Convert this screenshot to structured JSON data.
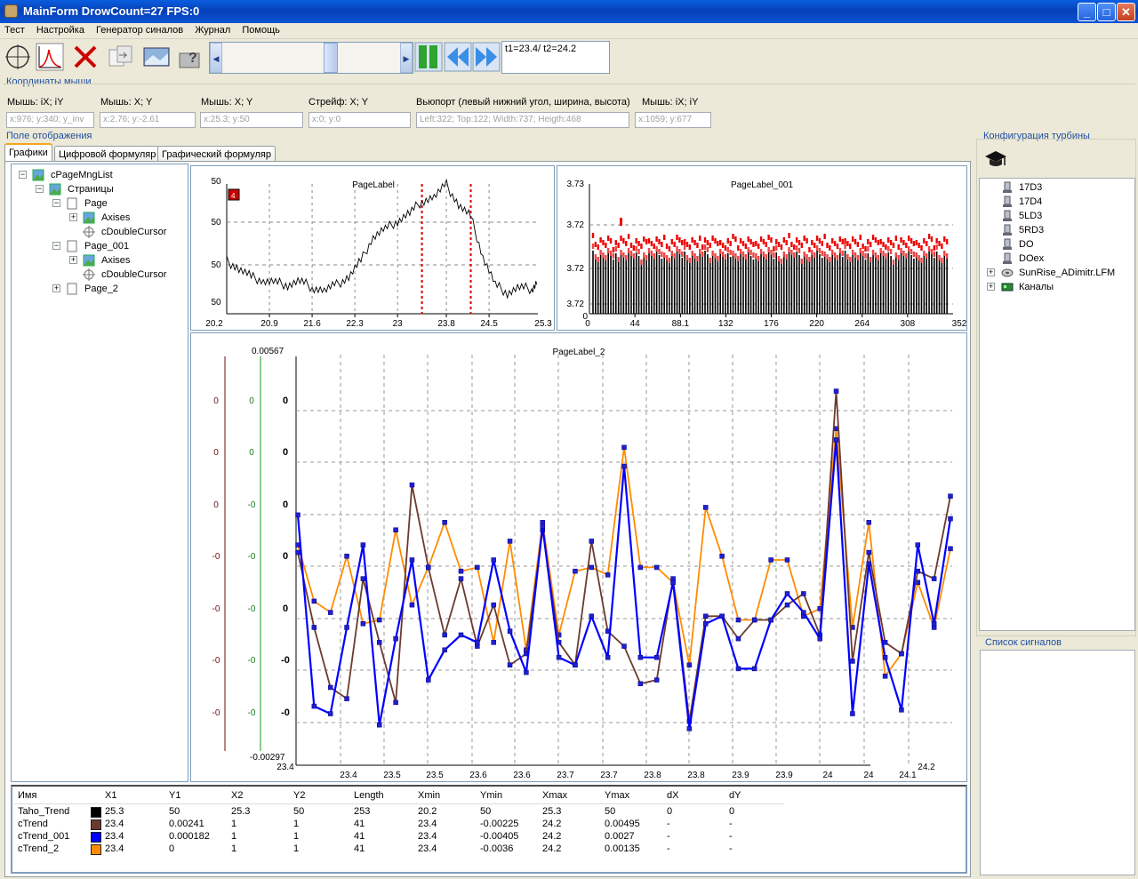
{
  "window": {
    "title": "MainForm DrowCount=27 FPS:0",
    "min": "_",
    "max": "□",
    "close": "✕"
  },
  "menu": [
    "Тест",
    "Настройка",
    "Генератор синалов",
    "Журнал",
    "Помощь"
  ],
  "toolbar": {
    "t1t2": "t1=23.4/ t2=24.2"
  },
  "mouse_coords": {
    "group": "Координаты мыши",
    "fields": [
      {
        "label": "Мышь: iX; iY",
        "value": "x:976; y:340; y_inv"
      },
      {
        "label": "Мышь: X; Y",
        "value": "x:2.76; y:-2.61"
      },
      {
        "label": "Мышь: X; Y",
        "value": "x:25.3; y:50"
      },
      {
        "label": "Стрейф: X; Y",
        "value": "x:0; y:0"
      },
      {
        "label": "Вьюпорт (левый нижний угол, ширина, высота)",
        "value": "Left:322; Top:122; Width:737; Heigth:468"
      },
      {
        "label": "Мышь: iX; iY",
        "value": "x:1059; y:677"
      }
    ]
  },
  "display": {
    "group": "Поле отображения",
    "tabs": [
      "Графики",
      "Цифровой формуляр",
      "Графический формуляр"
    ]
  },
  "tree": [
    {
      "label": "cPageMngList",
      "level": 0,
      "exp": "−",
      "icon": "page-manager"
    },
    {
      "label": "Страницы",
      "level": 1,
      "exp": "−",
      "icon": "pages"
    },
    {
      "label": "Page",
      "level": 2,
      "exp": "−",
      "icon": "page"
    },
    {
      "label": "Axises",
      "level": 3,
      "exp": "+",
      "icon": "axes"
    },
    {
      "label": "cDoubleCursor",
      "level": 3,
      "exp": "",
      "icon": "cursor"
    },
    {
      "label": "Page_001",
      "level": 2,
      "exp": "−",
      "icon": "page"
    },
    {
      "label": "Axises",
      "level": 3,
      "exp": "+",
      "icon": "axes"
    },
    {
      "label": "cDoubleCursor",
      "level": 3,
      "exp": "",
      "icon": "cursor"
    },
    {
      "label": "Page_2",
      "level": 2,
      "exp": "+",
      "icon": "page"
    }
  ],
  "turbine": {
    "group": "Конфигурация турбины",
    "items": [
      {
        "label": "17D3",
        "icon": "sensor",
        "exp": ""
      },
      {
        "label": "17D4",
        "icon": "sensor",
        "exp": ""
      },
      {
        "label": "5LD3",
        "icon": "sensor",
        "exp": ""
      },
      {
        "label": "5RD3",
        "icon": "sensor",
        "exp": ""
      },
      {
        "label": "DO",
        "icon": "sensor",
        "exp": ""
      },
      {
        "label": "DOex",
        "icon": "sensor",
        "exp": ""
      },
      {
        "label": "SunRise_ADimitr.LFM",
        "icon": "disk",
        "exp": "+"
      },
      {
        "label": "Каналы",
        "icon": "channels",
        "exp": "+"
      }
    ]
  },
  "signals": {
    "group": "Список сигналов"
  },
  "legend": {
    "headers": [
      "Имя",
      "X1",
      "Y1",
      "X2",
      "Y2",
      "Length",
      "Xmin",
      "Ymin",
      "Xmax",
      "Ymax",
      "dX",
      "dY"
    ],
    "rows": [
      {
        "name": "Taho_Trend",
        "color": "#000000",
        "cells": [
          "25.3",
          "50",
          "25.3",
          "50",
          "253",
          "20.2",
          "50",
          "25.3",
          "50",
          "0",
          "0"
        ]
      },
      {
        "name": "cTrend",
        "color": "#6b3a2e",
        "cells": [
          "23.4",
          "0.00241",
          "1",
          "1",
          "41",
          "23.4",
          "-0.00225",
          "24.2",
          "0.00495",
          "-",
          "-"
        ]
      },
      {
        "name": "cTrend_001",
        "color": "#0000ff",
        "cells": [
          "23.4",
          "0.000182",
          "1",
          "1",
          "41",
          "23.4",
          "-0.00405",
          "24.2",
          "0.0027",
          "-",
          "-"
        ]
      },
      {
        "name": "cTrend_2",
        "color": "#ff8c00",
        "cells": [
          "23.4",
          "0",
          "1",
          "1",
          "41",
          "23.4",
          "-0.0036",
          "24.2",
          "0.00135",
          "-",
          "-"
        ]
      }
    ]
  },
  "chart_data": [
    {
      "type": "line",
      "title": "PageLabel",
      "ytick_labels": [
        "50",
        "50",
        "50",
        "50"
      ],
      "xtick_labels": [
        "20.2",
        "20.9",
        "21.6",
        "22.3",
        "23",
        "23.8",
        "24.5",
        "25.3"
      ],
      "xlim": [
        20.2,
        25.3
      ],
      "cursors": [
        23.4,
        24.2
      ],
      "badge": "4",
      "series": [
        {
          "color": "#000000",
          "x": [
            20.2,
            20.4,
            20.6,
            20.8,
            21.0,
            21.2,
            21.4,
            21.6,
            21.8,
            22.0,
            22.2,
            22.4,
            22.6,
            22.8,
            23.0,
            23.2,
            23.4,
            23.6,
            23.8,
            24.0,
            24.2,
            24.4,
            24.6,
            24.8,
            25.0,
            25.2,
            25.3
          ],
          "y": [
            0.55,
            0.45,
            0.35,
            0.3,
            0.28,
            0.25,
            0.3,
            0.22,
            0.18,
            0.25,
            0.35,
            0.55,
            0.85,
            0.95,
            1.05,
            1.15,
            1.3,
            1.35,
            1.5,
            1.25,
            1.1,
            0.6,
            0.25,
            0.15,
            0.22,
            0.2,
            0.3
          ]
        }
      ]
    },
    {
      "type": "bar",
      "title": "PageLabel_001",
      "ytick_labels": [
        "3.73",
        "3.72",
        "3.72",
        "3.72",
        "0"
      ],
      "xtick_labels": [
        "0",
        "44",
        "88.1",
        "132",
        "176",
        "220",
        "264",
        "308",
        "352"
      ],
      "xlim": [
        0,
        352
      ],
      "bars": 140
    },
    {
      "type": "line",
      "title": "PageLabel_2",
      "y_top": "0.00567",
      "y_bottom": "-0.00297",
      "left_axis_labels": [
        "0",
        "0",
        "0",
        "-0",
        "-0",
        "-0",
        "-0"
      ],
      "green_axis_labels": [
        "0",
        "0",
        "-0",
        "-0",
        "-0",
        "-0",
        "-0"
      ],
      "bold_axis_labels": [
        "0",
        "0",
        "0",
        "0",
        "0",
        "-0",
        "-0"
      ],
      "xtick_labels": [
        "23.4",
        "23.4",
        "23.5",
        "23.5",
        "23.6",
        "23.6",
        "23.7",
        "23.7",
        "23.8",
        "23.8",
        "23.9",
        "23.9",
        "24",
        "24",
        "24.1",
        "24.2"
      ],
      "x_start": "23.4",
      "series": [
        {
          "name": "cTrend",
          "color": "#6b3a2e",
          "y": [
            0.52,
            0.32,
            0.16,
            0.13,
            0.45,
            0.28,
            0.12,
            0.7,
            0.48,
            0.3,
            0.45,
            0.27,
            0.38,
            0.22,
            0.25,
            0.58,
            0.28,
            0.22,
            0.55,
            0.31,
            0.27,
            0.17,
            0.18,
            0.45,
            0.07,
            0.35,
            0.35,
            0.29,
            0.34,
            0.34,
            0.38,
            0.41,
            0.3,
            0.95,
            0.23,
            0.52,
            0.28,
            0.25,
            0.47,
            0.45,
            0.67
          ]
        },
        {
          "name": "cTrend_001",
          "color": "#0000ff",
          "y": [
            0.62,
            0.11,
            0.09,
            0.32,
            0.54,
            0.06,
            0.29,
            0.5,
            0.18,
            0.26,
            0.3,
            0.28,
            0.5,
            0.31,
            0.2,
            0.59,
            0.24,
            0.22,
            0.35,
            0.24,
            0.75,
            0.24,
            0.24,
            0.44,
            0.05,
            0.33,
            0.35,
            0.21,
            0.21,
            0.34,
            0.41,
            0.36,
            0.29,
            0.82,
            0.09,
            0.49,
            0.24,
            0.1,
            0.54,
            0.33,
            0.61
          ]
        },
        {
          "name": "cTrend_2",
          "color": "#ff8c00",
          "y": [
            0.54,
            0.39,
            0.36,
            0.51,
            0.33,
            0.34,
            0.58,
            0.38,
            0.48,
            0.6,
            0.47,
            0.48,
            0.28,
            0.55,
            0.26,
            0.6,
            0.3,
            0.47,
            0.48,
            0.46,
            0.8,
            0.48,
            0.48,
            0.44,
            0.22,
            0.64,
            0.51,
            0.34,
            0.34,
            0.5,
            0.5,
            0.35,
            0.37,
            0.85,
            0.32,
            0.6,
            0.19,
            0.25,
            0.44,
            0.32,
            0.53
          ]
        }
      ]
    }
  ]
}
